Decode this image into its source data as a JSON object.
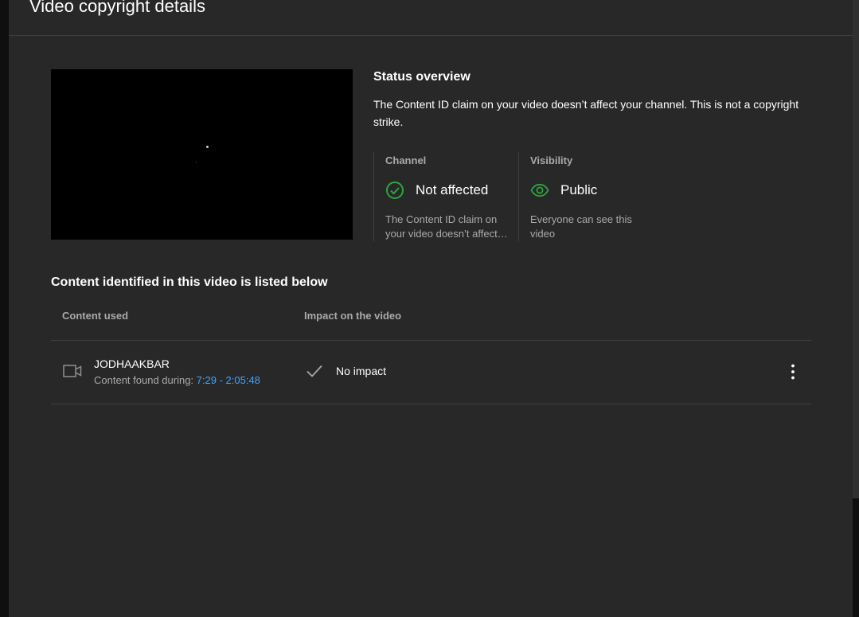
{
  "dialog": {
    "title": "Video copyright details"
  },
  "status": {
    "title": "Status overview",
    "description": "The Content ID claim on your video doesn’t affect your channel. This is not a copyright strike.",
    "channel": {
      "label": "Channel",
      "value": "Not affected",
      "icon": "check-circle-icon",
      "description_line1": "The Content ID claim on",
      "description_line2": "your video doesn’t affect…",
      "color": "#2ba640"
    },
    "visibility": {
      "label": "Visibility",
      "value": "Public",
      "icon": "eye-icon",
      "description": "Everyone can see this video",
      "color": "#2ba640"
    }
  },
  "content": {
    "section_title": "Content identified in this video is listed below",
    "columns": {
      "content_used": "Content used",
      "impact": "Impact on the video"
    },
    "rows": [
      {
        "name": "JODHAAKBAR",
        "found_label": "Content found during:",
        "time_range": "7:29 - 2:05:48",
        "icon": "video-camera-icon",
        "impact": "No impact",
        "impact_icon": "check-icon",
        "menu_icon": "more-vert-icon"
      }
    ]
  },
  "colors": {
    "background": "#282828",
    "link": "#3ea6ff",
    "secondary_text": "#aaaaaa",
    "success": "#2ba640"
  }
}
